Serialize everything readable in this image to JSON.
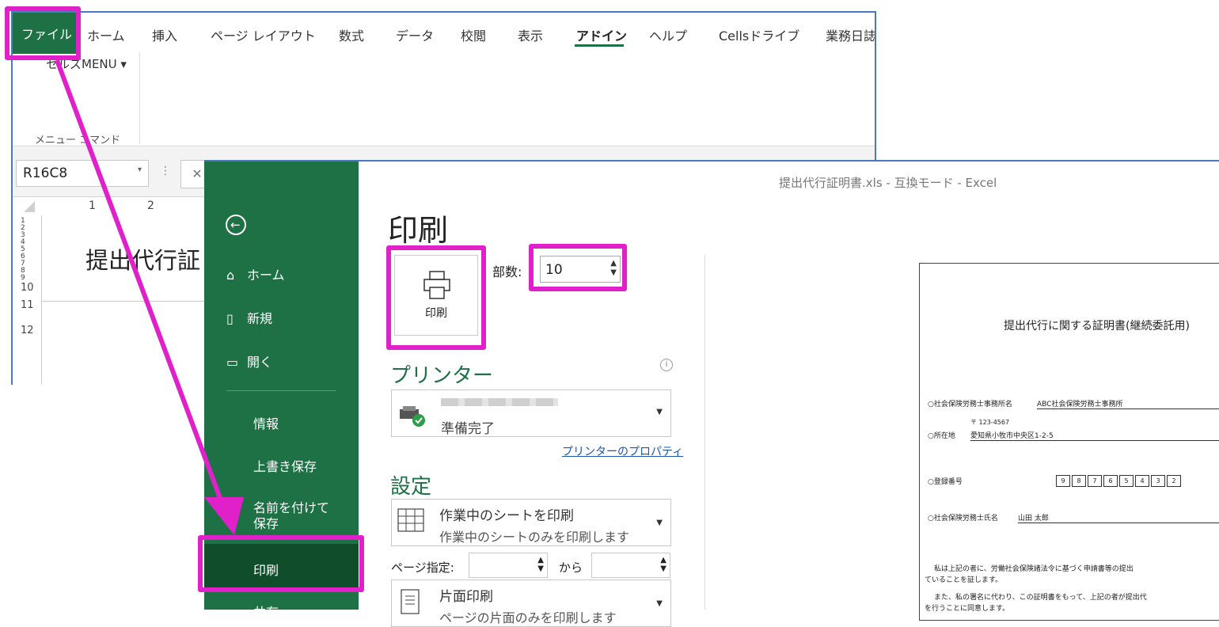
{
  "ribbon": {
    "tabs": [
      "ファイル",
      "ホーム",
      "挿入",
      "ページ レイアウト",
      "数式",
      "データ",
      "校閲",
      "表示",
      "アドイン",
      "ヘルプ",
      "Cellsドライブ",
      "業務日誌"
    ],
    "active_tab": "アドイン",
    "menu_button": "セルズMENU ▾",
    "group_label": "メニュー コマンド"
  },
  "formula_bar": {
    "name_box": "R16C8",
    "cancel": "✕"
  },
  "grid": {
    "columns": [
      "1",
      "2"
    ],
    "rows": [
      "1",
      "2",
      "3",
      "4",
      "5",
      "6",
      "7",
      "8",
      "9",
      "10",
      "11",
      "12"
    ],
    "cell_text": "提出代行証"
  },
  "backstage": {
    "window_title": "提出代行証明書.xls  -  互換モード  -  Excel",
    "sidebar": {
      "home": "ホーム",
      "new": "新規",
      "open": "開く",
      "info": "情報",
      "save": "上書き保存",
      "save_as": "名前を付けて保存",
      "print": "印刷",
      "share": "共有"
    },
    "print_heading": "印刷",
    "print_button": "印刷",
    "copies_label": "部数:",
    "copies_value": "10",
    "printer_heading": "プリンター",
    "printer_status": "準備完了",
    "printer_properties": "プリンターのプロパティ",
    "settings_heading": "設定",
    "settings": [
      {
        "main": "作業中のシートを印刷",
        "sub": "作業中のシートのみを印刷します"
      },
      {
        "main": "片面印刷",
        "sub": "ページの片面のみを印刷します"
      }
    ],
    "page_label": "ページ指定:",
    "page_to": "から"
  },
  "preview": {
    "title": "提出代行に関する証明書(継続委託用)",
    "office_label": "○社会保険労務士事務所名",
    "office_value": "ABC社会保険労務士事務所",
    "postal": "〒 123-4567",
    "address_label": "○所在地",
    "address_value": "愛知県小牧市中央区1-2-5",
    "reg_label": "○登録番号",
    "reg_digits": [
      "9",
      "8",
      "7",
      "6",
      "5",
      "4",
      "3",
      "2"
    ],
    "name_label": "○社会保険労務士氏名",
    "name_value": "山田  太郎",
    "body1": "私は上記の者に、労働社会保険諸法令に基づく申請書等の提出",
    "body2": "ていることを証します。",
    "body3": "また、私の署名に代わり、この証明書をもって、上記の者が提出代",
    "body4": "を行うことに同意します。"
  },
  "colors": {
    "excel_green": "#1e7145",
    "dark_green": "#0f4d2b",
    "highlight": "#e020c8",
    "window_border": "#4a78c2"
  }
}
